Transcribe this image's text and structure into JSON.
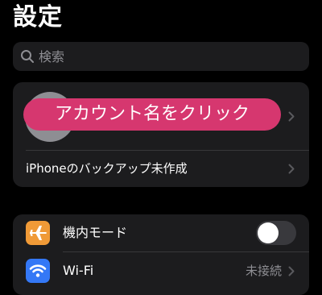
{
  "header": {
    "title": "設定"
  },
  "search": {
    "placeholder": "検索"
  },
  "account": {
    "overlay_label": "アカウント名をクリック",
    "backup_label": "iPhoneのバックアップ未作成"
  },
  "settings": {
    "rows": [
      {
        "label": "機内モード",
        "icon": "airplane-icon",
        "icon_color": "#f09a37",
        "toggle_on": false
      },
      {
        "label": "Wi-Fi",
        "icon": "wifi-icon",
        "icon_color": "#3478f6",
        "value": "未接続"
      }
    ]
  },
  "colors": {
    "background": "#000000",
    "group_background": "#1c1c1e",
    "accent_pill": "#d6376f",
    "secondary_text": "#8e8e93"
  }
}
